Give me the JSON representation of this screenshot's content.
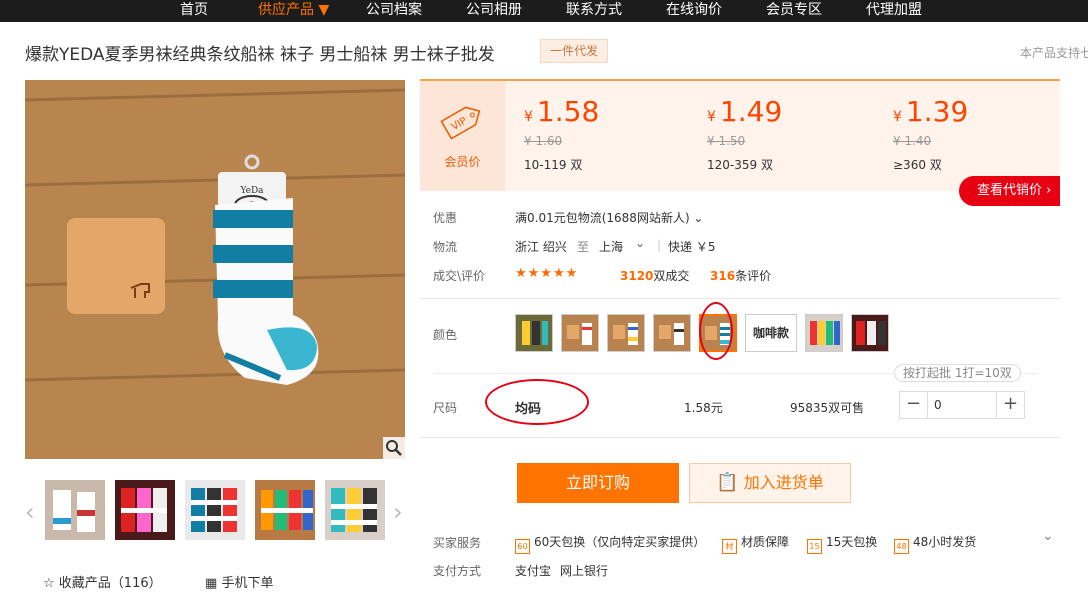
{
  "nav": {
    "items": [
      "首页",
      "供应产品 ▼",
      "公司档案",
      "公司相册",
      "联系方式",
      "在线询价",
      "会员专区",
      "代理加盟"
    ]
  },
  "product": {
    "title": "爆款YEDA夏季男袜经典条纹船袜 袜子 男士船袜 男士袜子批发",
    "tag": "一件代发",
    "support": "本产品支持七"
  },
  "gallery": {
    "zoom_icon": "magnifier-icon",
    "brand": "YeDa"
  },
  "favorite": {
    "label": "收藏产品（116）"
  },
  "mobile": {
    "label": "手机下单"
  },
  "pricing": {
    "vip_label": "会员价",
    "vip_badge": "VIP",
    "tiers": [
      {
        "currency": "¥",
        "price": "1.58",
        "old": "¥ 1.60",
        "range": "10-119 双"
      },
      {
        "currency": "¥",
        "price": "1.49",
        "old": "¥ 1.50",
        "range": "120-359 双"
      },
      {
        "currency": "¥",
        "price": "1.39",
        "old": "¥ 1.40",
        "range": "≥360 双"
      }
    ],
    "dealer_button": "查看代销价 ›"
  },
  "info": {
    "promo_label": "优惠",
    "promo_value": "满0.01元包物流(1688网站新人) ⌄",
    "logistics_label": "物流",
    "logistics_from": "浙江 绍兴",
    "logistics_to_word": "至",
    "logistics_dest": "上海",
    "logistics_dropdown": "⌄",
    "logistics_sep": "|",
    "logistics_express": "快递 ￥5",
    "deals_label": "成交\\评价",
    "stars": "★★★★★",
    "deal_count": "3120",
    "deal_unit": "双成交",
    "review_count": "316",
    "review_unit": "条评价"
  },
  "color": {
    "label": "颜色",
    "text_option": "咖啡款"
  },
  "size": {
    "label": "尺码",
    "hint": "按打起批 1打=10双",
    "value": "均码",
    "price": "1.58元",
    "stock": "95835双可售",
    "minus": "−",
    "plus": "+",
    "quantity": "0"
  },
  "actions": {
    "order": "立即订购",
    "cart": "加入进货单"
  },
  "service": {
    "label": "买家服务",
    "items": [
      {
        "icon": "60",
        "text": "60天包换（仅向特定买家提供）"
      },
      {
        "icon": "材",
        "text": "材质保障"
      },
      {
        "icon": "15",
        "text": "15天包换"
      },
      {
        "icon": "48",
        "text": "48小时发货"
      }
    ],
    "expand": "⌄"
  },
  "payment": {
    "label": "支付方式",
    "methods": [
      "支付宝",
      "网上银行"
    ]
  },
  "colors": {
    "accent": "#ff7300",
    "price": "#ff4400",
    "red": "#e60012"
  }
}
